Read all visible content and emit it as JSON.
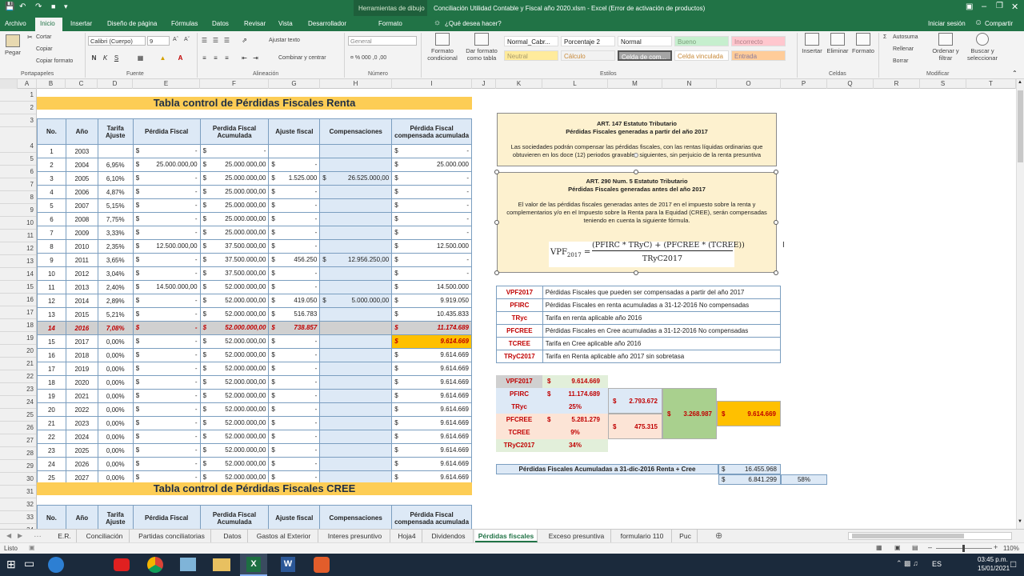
{
  "titlebar": {
    "context": "Herramientas de dibujo",
    "title": "Conciliación Utilidad Contable y Fiscal año 2020.xlsm - Excel (Error de activación de productos)"
  },
  "tabs": {
    "items": [
      "Archivo",
      "Inicio",
      "Insertar",
      "Diseño de página",
      "Fórmulas",
      "Datos",
      "Revisar",
      "Vista",
      "Desarrollador",
      "Formato"
    ],
    "search": "¿Qué desea hacer?",
    "signin": "Iniciar sesión",
    "share": "Compartir"
  },
  "ribbon": {
    "clipboard": {
      "paste": "Pegar",
      "cut": "Cortar",
      "copy": "Copiar",
      "format_painter": "Copiar formato",
      "group": "Portapapeles"
    },
    "font": {
      "name": "Calibri (Cuerpo)",
      "size": "9",
      "bold": "N",
      "italic": "K",
      "underline": "S",
      "group": "Fuente"
    },
    "alignment": {
      "wrap": "Ajustar texto",
      "merge": "Combinar y centrar",
      "group": "Alineación"
    },
    "number": {
      "format": "General",
      "group": "Número"
    },
    "styles": {
      "cond_format": "Formato condicional",
      "as_table": "Dar formato como tabla",
      "cells": [
        "Normal_Cabr...",
        "Porcentaje 2",
        "Normal",
        "Bueno",
        "Incorrecto",
        "Neutral",
        "Cálculo",
        "Celda de com...",
        "Celda vinculada",
        "Entrada"
      ],
      "group": "Estilos"
    },
    "cells_group": {
      "insert": "Insertar",
      "delete": "Eliminar",
      "format": "Formato",
      "group": "Celdas"
    },
    "editing": {
      "autosum": "Autosuma",
      "fill": "Rellenar",
      "clear": "Borrar",
      "sort": "Ordenar y filtrar",
      "find": "Buscar y seleccionar",
      "group": "Modificar"
    }
  },
  "columns": [
    "A",
    "B",
    "C",
    "D",
    "E",
    "F",
    "G",
    "H",
    "I",
    "J",
    "K",
    "L",
    "M",
    "N",
    "O",
    "P",
    "Q",
    "R",
    "S",
    "T"
  ],
  "rows": [
    "1",
    "2",
    "3",
    "4",
    "5",
    "6",
    "7",
    "8",
    "9",
    "10",
    "11",
    "12",
    "13",
    "14",
    "15",
    "16",
    "17",
    "18",
    "19",
    "20",
    "21",
    "22",
    "23",
    "24",
    "25",
    "26",
    "27",
    "28",
    "29",
    "30",
    "31",
    "32",
    "33",
    "34"
  ],
  "renta_table": {
    "title": "Tabla control de Pérdidas Fiscales Renta",
    "headers": [
      "No.",
      "Año",
      "Tarifa Ajuste",
      "Pérdida Fiscal",
      "Perdida Fiscal Acumulada",
      "Ajuste fiscal",
      "Compensaciones",
      "Pérdida Fiscal compensada acumulada"
    ],
    "currency": "$",
    "rows": [
      [
        "1",
        "2003",
        "",
        "-",
        "-",
        "",
        "",
        "-"
      ],
      [
        "2",
        "2004",
        "6,95%",
        "25.000.000,00",
        "25.000.000,00",
        "-",
        "",
        "25.000.000"
      ],
      [
        "3",
        "2005",
        "6,10%",
        "-",
        "25.000.000,00",
        "1.525.000",
        "26.525.000,00",
        "-"
      ],
      [
        "4",
        "2006",
        "4,87%",
        "-",
        "25.000.000,00",
        "-",
        "",
        "-"
      ],
      [
        "5",
        "2007",
        "5,15%",
        "-",
        "25.000.000,00",
        "-",
        "",
        "-"
      ],
      [
        "6",
        "2008",
        "7,75%",
        "-",
        "25.000.000,00",
        "-",
        "",
        "-"
      ],
      [
        "7",
        "2009",
        "3,33%",
        "-",
        "25.000.000,00",
        "-",
        "",
        "-"
      ],
      [
        "8",
        "2010",
        "2,35%",
        "12.500.000,00",
        "37.500.000,00",
        "-",
        "",
        "12.500.000"
      ],
      [
        "9",
        "2011",
        "3,65%",
        "-",
        "37.500.000,00",
        "456.250",
        "12.956.250,00",
        "-"
      ],
      [
        "10",
        "2012",
        "3,04%",
        "-",
        "37.500.000,00",
        "-",
        "",
        "-"
      ],
      [
        "11",
        "2013",
        "2,40%",
        "14.500.000,00",
        "52.000.000,00",
        "-",
        "",
        "14.500.000"
      ],
      [
        "12",
        "2014",
        "2,89%",
        "-",
        "52.000.000,00",
        "419.050",
        "5.000.000,00",
        "9.919.050"
      ],
      [
        "13",
        "2015",
        "5,21%",
        "-",
        "52.000.000,00",
        "516.783",
        "",
        "10.435.833"
      ],
      [
        "14",
        "2016",
        "7,08%",
        "-",
        "52.000.000,00",
        "738.857",
        "",
        "11.174.689"
      ],
      [
        "15",
        "2017",
        "0,00%",
        "-",
        "52.000.000,00",
        "-",
        "",
        "9.614.669"
      ],
      [
        "16",
        "2018",
        "0,00%",
        "-",
        "52.000.000,00",
        "-",
        "",
        "9.614.669"
      ],
      [
        "17",
        "2019",
        "0,00%",
        "-",
        "52.000.000,00",
        "-",
        "",
        "9.614.669"
      ],
      [
        "18",
        "2020",
        "0,00%",
        "-",
        "52.000.000,00",
        "-",
        "",
        "9.614.669"
      ],
      [
        "19",
        "2021",
        "0,00%",
        "-",
        "52.000.000,00",
        "-",
        "",
        "9.614.669"
      ],
      [
        "20",
        "2022",
        "0,00%",
        "-",
        "52.000.000,00",
        "-",
        "",
        "9.614.669"
      ],
      [
        "21",
        "2023",
        "0,00%",
        "-",
        "52.000.000,00",
        "-",
        "",
        "9.614.669"
      ],
      [
        "22",
        "2024",
        "0,00%",
        "-",
        "52.000.000,00",
        "-",
        "",
        "9.614.669"
      ],
      [
        "23",
        "2025",
        "0,00%",
        "-",
        "52.000.000,00",
        "-",
        "",
        "9.614.669"
      ],
      [
        "24",
        "2026",
        "0,00%",
        "-",
        "52.000.000,00",
        "-",
        "",
        "9.614.669"
      ],
      [
        "25",
        "2027",
        "0,00%",
        "-",
        "52.000.000,00",
        "-",
        "",
        "9.614.669"
      ]
    ]
  },
  "cree_table": {
    "title": "Tabla control de Pérdidas Fiscales CREE",
    "headers": [
      "No.",
      "Año",
      "Tarifa Ajuste",
      "Pérdida Fiscal",
      "Perdida Fiscal Acumulada",
      "Ajuste fiscal",
      "Compensaciones",
      "Pérdida Fiscal compensada acumulada"
    ]
  },
  "art147": {
    "title1": "ART. 147 Estatuto Tributario",
    "title2": "Pérdidas Fiscales generadas a partir del año 2017",
    "body": "Las sociedades podrán compensar las pérdidas fiscales, con las rentas líquidas ordinarias que obtuvieren en los doce (12) periodos gravables siguientes, sin perjuicio de la renta presuntiva"
  },
  "art290": {
    "title1": "ART. 290 Num. 5 Estatuto Tributario",
    "title2": "Pérdidas Fiscales generadas antes del año 2017",
    "body": "El valor de las pérdidas fiscales generadas antes de 2017 en el impuesto sobre la renta y complementarios y/o en el Impuesto sobre la Renta para la Equidad (CREE), serán compensadas teniendo en cuenta la siguiente fórmula.",
    "formula_lhs": "VPF",
    "formula_lhs_sub": "2017",
    "formula_num": "(PF",
    "formula_num_full": "(PFIRC * TRyC) + (PFCREE * (TCREE))",
    "formula_den": "TRyC2017"
  },
  "legend": [
    {
      "key": "VPF2017",
      "desc": "Pérdidas Fiscales que pueden ser compensadas a partir del año 2017"
    },
    {
      "key": "PFIRC",
      "desc": "Pérdidas Fiscales en renta acumuladas a 31-12-2016 No compensadas"
    },
    {
      "key": "TRyc",
      "desc": "Tarifa en renta aplicable año 2016"
    },
    {
      "key": "PFCREE",
      "desc": "Pérdidas Fiscales en Cree acumuladas a 31-12-2016 No compensadas"
    },
    {
      "key": "TCREE",
      "desc": "Tarifa en Cree aplicable año 2016"
    },
    {
      "key": "TRyC2017",
      "desc": "Tarifa en Renta aplicable año 2017 sin sobretasa"
    }
  ],
  "calc": {
    "labels": [
      "VPF2017",
      "PFIRC",
      "TRyc",
      "PFCREE",
      "TCREE",
      "TRyC2017"
    ],
    "values": [
      "9.614.669",
      "11.174.689",
      "25%",
      "5.281.279",
      "9%",
      "34%"
    ],
    "currency": "$",
    "prod1": "2.793.672",
    "prod2": "475.315",
    "sum": "3.268.987",
    "result": "9.614.669"
  },
  "accum": {
    "label": "Pérdidas Fiscales Acumuladas a 31-dic-2016 Renta + Cree",
    "v1": "16.455.968",
    "v2": "6.841.299",
    "pct": "58%"
  },
  "sheettabs": [
    "E.R.",
    "Conciliación",
    "Partidas conciliatorias",
    "Datos",
    "Gastos al Exterior",
    "Interes presuntivo",
    "Hoja4",
    "Dividendos",
    "Pérdidas fiscales",
    "Exceso presuntiva",
    "formulario 110",
    "Puc"
  ],
  "status": {
    "left": "Listo",
    "zoom": "110%"
  },
  "taskbar": {
    "lang": "ES",
    "time": "03:45 p.m.",
    "date": "15/01/2021"
  },
  "colors": {
    "excel_green": "#217346",
    "banner": "#fdcd55",
    "header_blue": "#dde9f6",
    "highlight": "#ffc000",
    "red": "#c00000",
    "green_cell": "#a9d08e"
  }
}
